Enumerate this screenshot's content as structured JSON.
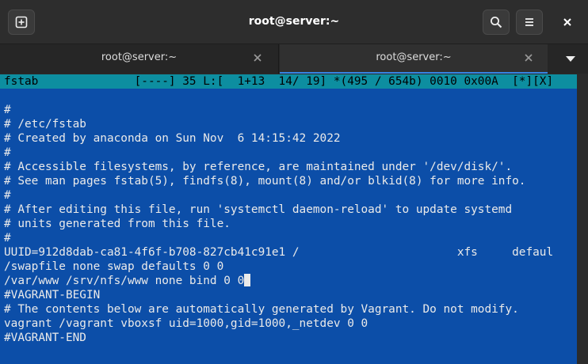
{
  "window": {
    "title": "root@server:~"
  },
  "tabs": [
    {
      "label": "root@server:~",
      "active": false
    },
    {
      "label": "root@server:~",
      "active": true
    }
  ],
  "editor": {
    "status": "fstab              [----] 35 L:[  1+13  14/ 19] *(495 / 654b) 0010 0x00A  [*][X]",
    "lines": [
      "",
      "#",
      "# /etc/fstab",
      "# Created by anaconda on Sun Nov  6 14:15:42 2022",
      "#",
      "# Accessible filesystems, by reference, are maintained under '/dev/disk/'.",
      "# See man pages fstab(5), findfs(8), mount(8) and/or blkid(8) for more info.",
      "#",
      "# After editing this file, run 'systemctl daemon-reload' to update systemd",
      "# units generated from this file.",
      "#",
      "UUID=912d8dab-ca81-4f6f-b708-827cb41c91e1 /                       xfs     defaul",
      "/swapfile none swap defaults 0 0",
      "/var/www /srv/nfs/www none bind 0 0",
      "#VAGRANT-BEGIN",
      "# The contents below are automatically generated by Vagrant. Do not modify.",
      "vagrant /vagrant vboxsf uid=1000,gid=1000,_netdev 0 0",
      "#VAGRANT-END"
    ]
  },
  "colors": {
    "terminal_bg": "#0c4ea8",
    "status_bg": "#0d8ea0",
    "tab_accent": "#3584e4"
  },
  "icons": {
    "new_tab": "new-tab-icon",
    "search": "search-icon",
    "menu": "hamburger-menu-icon",
    "close": "close-icon",
    "tab_close": "close-icon",
    "tab_menu": "chevron-down-icon"
  }
}
